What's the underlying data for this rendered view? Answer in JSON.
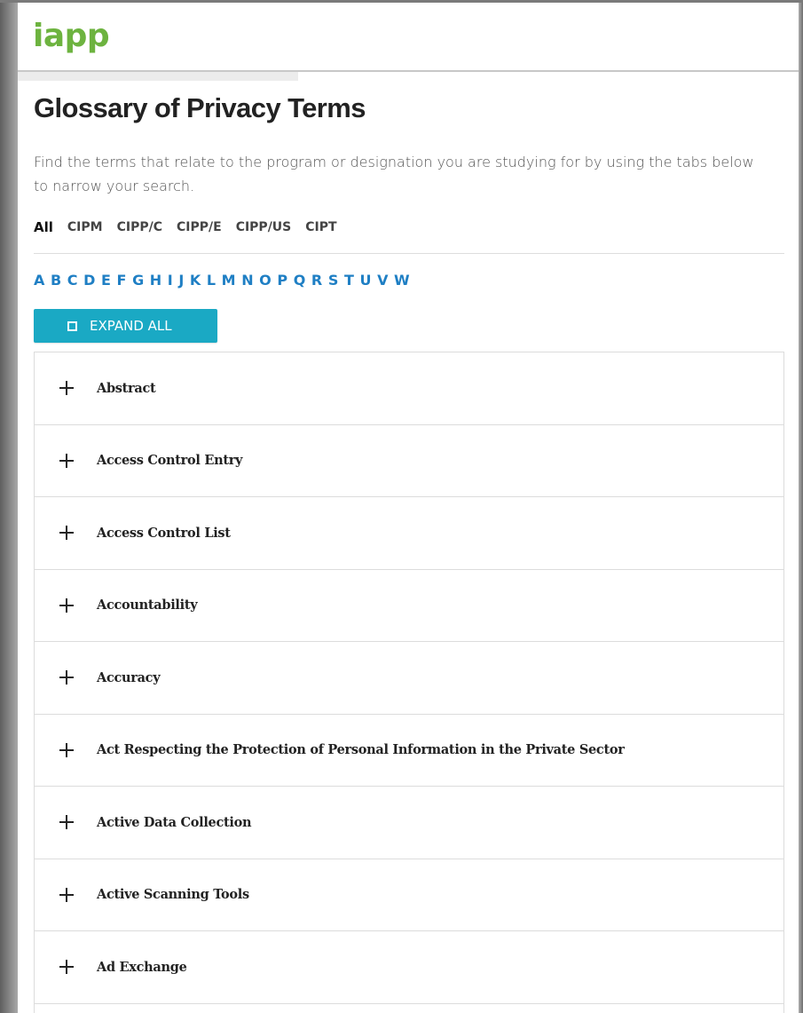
{
  "header": {
    "logo_text": "iapp",
    "logo_color": "#6db33f"
  },
  "page": {
    "title": "Glossary of Privacy Terms",
    "intro": "Find the terms that relate to the program or designation you are studying for by using the tabs below to narrow your search."
  },
  "tabs": [
    {
      "label": "All",
      "active": true
    },
    {
      "label": "CIPM",
      "active": false
    },
    {
      "label": "CIPP/C",
      "active": false
    },
    {
      "label": "CIPP/E",
      "active": false
    },
    {
      "label": "CIPP/US",
      "active": false
    },
    {
      "label": "CIPT",
      "active": false
    }
  ],
  "letters": [
    "A",
    "B",
    "C",
    "D",
    "E",
    "F",
    "G",
    "H",
    "I",
    "J",
    "K",
    "L",
    "M",
    "N",
    "O",
    "P",
    "Q",
    "R",
    "S",
    "T",
    "U",
    "V",
    "W"
  ],
  "letter_color": "#1f7fc4",
  "expand_button": {
    "label": "EXPAND ALL",
    "icon": "expand-icon",
    "color": "#1aa9c4"
  },
  "terms": [
    {
      "label": "Abstract",
      "icon": "plus-icon"
    },
    {
      "label": "Access Control Entry",
      "icon": "plus-icon"
    },
    {
      "label": "Access Control List",
      "icon": "plus-icon"
    },
    {
      "label": "Accountability",
      "icon": "plus-icon"
    },
    {
      "label": "Accuracy",
      "icon": "plus-icon"
    },
    {
      "label": "Act Respecting the Protection of Personal Information in the Private Sector",
      "icon": "plus-icon"
    },
    {
      "label": "Active Data Collection",
      "icon": "plus-icon"
    },
    {
      "label": "Active Scanning Tools",
      "icon": "plus-icon"
    },
    {
      "label": "Ad Exchange",
      "icon": "plus-icon"
    }
  ]
}
